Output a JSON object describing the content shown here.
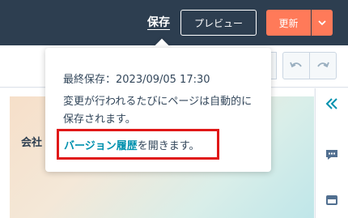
{
  "header": {
    "save_label": "保存",
    "preview_label": "プレビュー",
    "update_label": "更新"
  },
  "canvas": {
    "hero_text": "会社"
  },
  "popover": {
    "last_saved": "最終保存：2023/09/05 17:30",
    "message": "変更が行われるたびにページは自動的に保存されます。",
    "link_label": "バージョン履歴",
    "link_suffix": "を開きます。"
  },
  "colors": {
    "header_bg": "#2d3e50",
    "accent_orange": "#ff7a59",
    "link_teal": "#0091ae",
    "highlight_red": "#e01818"
  },
  "icons": [
    "chevron-down-icon",
    "undo-icon",
    "redo-icon",
    "collapse-double-chevron-icon",
    "comment-icon",
    "panel-icon"
  ]
}
